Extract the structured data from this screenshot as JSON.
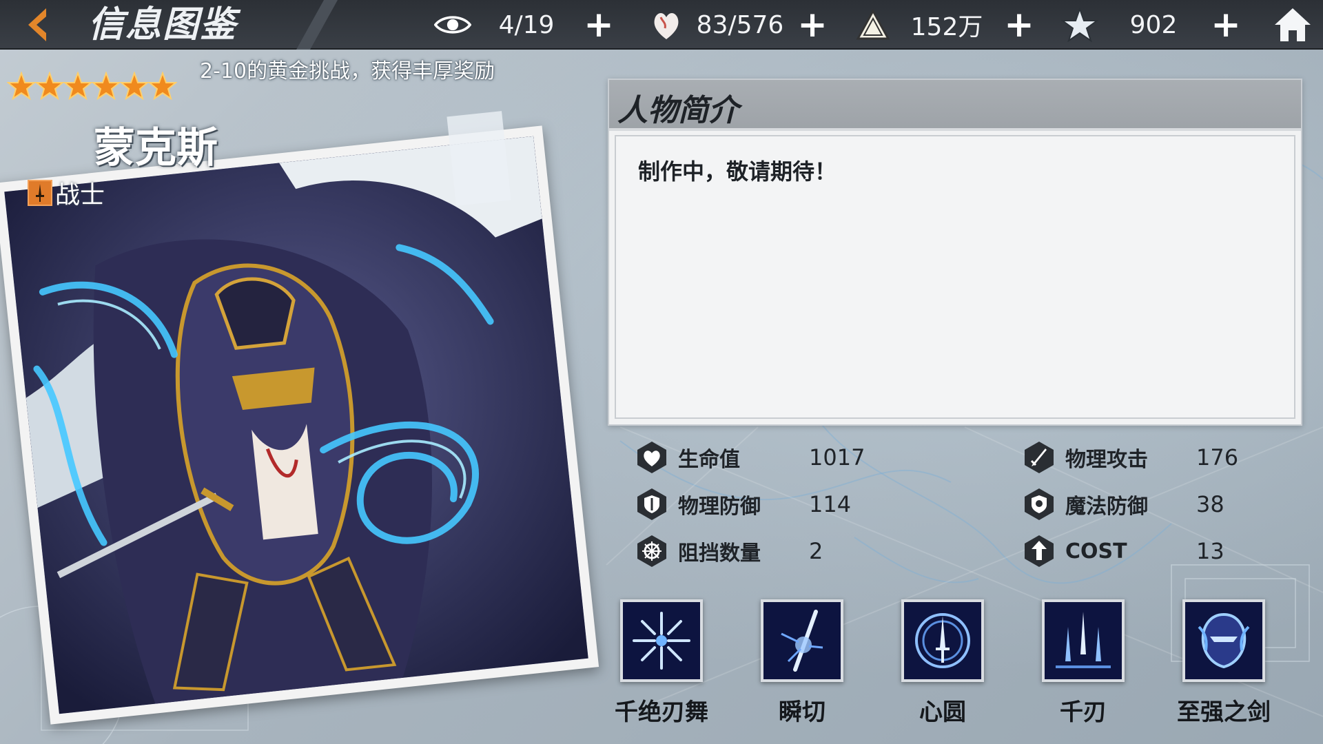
{
  "header": {
    "title": "信息图鉴",
    "resources": [
      {
        "icon": "eye-icon",
        "value": "4/19"
      },
      {
        "icon": "heart-flame-icon",
        "value": "83/576"
      },
      {
        "icon": "triangle-coin-icon",
        "value": "152万"
      },
      {
        "icon": "star-crystal-icon",
        "value": "902"
      }
    ],
    "plus_label": "+"
  },
  "event_text": "2-10的黄金挑战，获得丰厚奖励",
  "character": {
    "stars": 6,
    "name": "蒙克斯",
    "class": "战士"
  },
  "profile": {
    "title": "人物简介",
    "text": "制作中，敬请期待！"
  },
  "stats": [
    {
      "icon": "heart-shield-icon",
      "label": "生命值",
      "value": "1017"
    },
    {
      "icon": "sword-shield-icon",
      "label": "物理攻击",
      "value": "176"
    },
    {
      "icon": "shield-icon",
      "label": "物理防御",
      "value": "114"
    },
    {
      "icon": "magic-shield-icon",
      "label": "魔法防御",
      "value": "38"
    },
    {
      "icon": "block-icon",
      "label": "阻挡数量",
      "value": "2"
    },
    {
      "icon": "cost-icon",
      "label": "COST",
      "value": "13"
    }
  ],
  "skills": [
    {
      "icon": "burst-blades-icon",
      "name": "千绝刃舞"
    },
    {
      "icon": "slash-icon",
      "name": "瞬切"
    },
    {
      "icon": "sword-circle-icon",
      "name": "心圆"
    },
    {
      "icon": "three-blades-icon",
      "name": "千刃"
    },
    {
      "icon": "armored-helm-icon",
      "name": "至强之剑"
    }
  ],
  "colors": {
    "topbar": "#2c3036",
    "accent_orange": "#e07b2a",
    "skill_bg": "#0d1440",
    "glow_blue": "#46c8ff"
  }
}
